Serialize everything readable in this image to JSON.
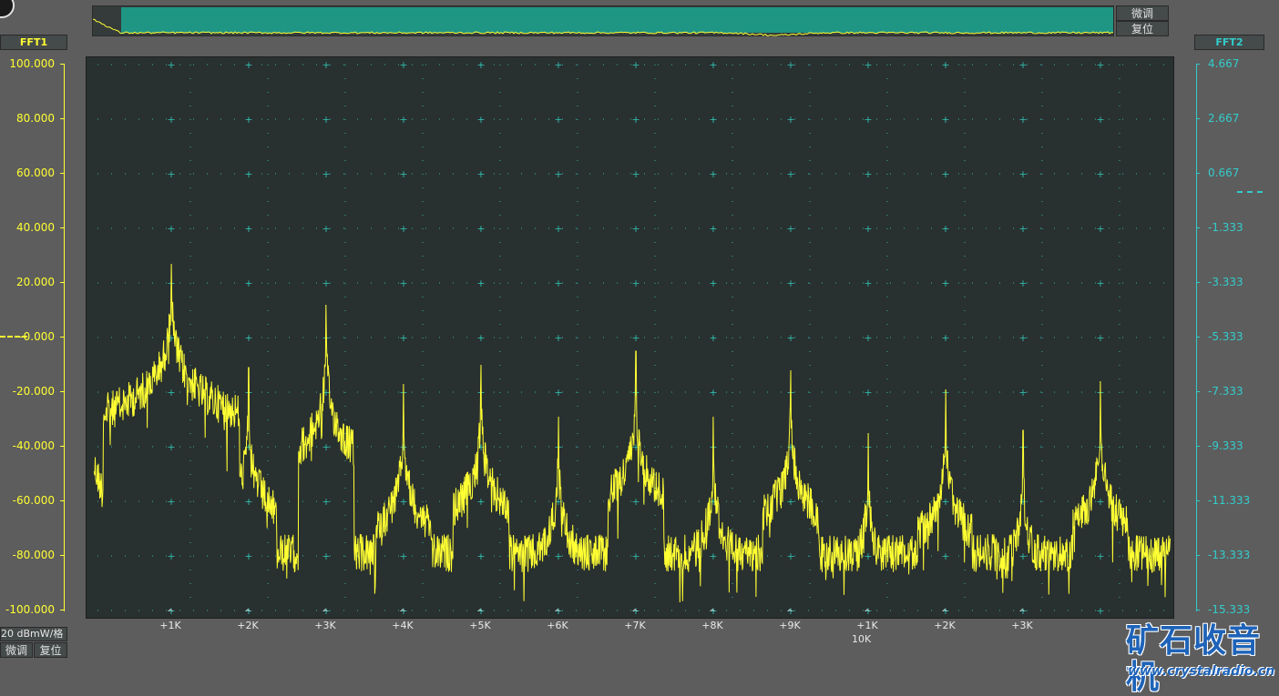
{
  "overview": {
    "fine_tune": "微调",
    "reset": "复位"
  },
  "left_axis": {
    "title": "FFT1",
    "ticks": [
      "100.000",
      "80.000",
      "60.000",
      "40.000",
      "20.000",
      "-0.000",
      "-20.000",
      "-40.000",
      "-60.000",
      "-80.000",
      "-100.000"
    ],
    "scale_label": "20 dBmW/格",
    "fine_tune": "微调",
    "reset": "复位",
    "color": "#ffff33"
  },
  "right_axis": {
    "title": "FFT2",
    "ticks": [
      "4.667",
      "2.667",
      "0.667",
      "-1.333",
      "-3.333",
      "-5.333",
      "-7.333",
      "-9.333",
      "-11.333",
      "-13.333",
      "-15.333"
    ],
    "color": "#33cccc"
  },
  "x_axis": {
    "tick_labels": [
      "+1K",
      "+2K",
      "+3K",
      "+4K",
      "+5K",
      "+6K",
      "+7K",
      "+8K",
      "+9K",
      "+1K",
      "+2K",
      "+3K"
    ],
    "label": "10K"
  },
  "watermark": {
    "title": "矿石收音机",
    "url": "www.crystalradio.cn"
  },
  "chart_data": {
    "type": "line",
    "title": "",
    "xlabel": "10K",
    "ylabel": "",
    "x_range_hz": [
      0,
      13900
    ],
    "ylim": [
      -100,
      100
    ],
    "grid": true,
    "series": [
      {
        "color": "#ffff33",
        "noise_floor": -72,
        "peaks": [
          {
            "x": 1000,
            "y": 27
          },
          {
            "x": 2000,
            "y": -11
          },
          {
            "x": 3000,
            "y": 12
          },
          {
            "x": 4000,
            "y": -17
          },
          {
            "x": 5000,
            "y": -10
          },
          {
            "x": 6000,
            "y": -29
          },
          {
            "x": 7000,
            "y": -5
          },
          {
            "x": 8000,
            "y": -29
          },
          {
            "x": 9000,
            "y": -12
          },
          {
            "x": 10000,
            "y": -35
          },
          {
            "x": 11000,
            "y": -19
          },
          {
            "x": 12000,
            "y": -34
          },
          {
            "x": 13000,
            "y": -16
          }
        ]
      }
    ]
  }
}
